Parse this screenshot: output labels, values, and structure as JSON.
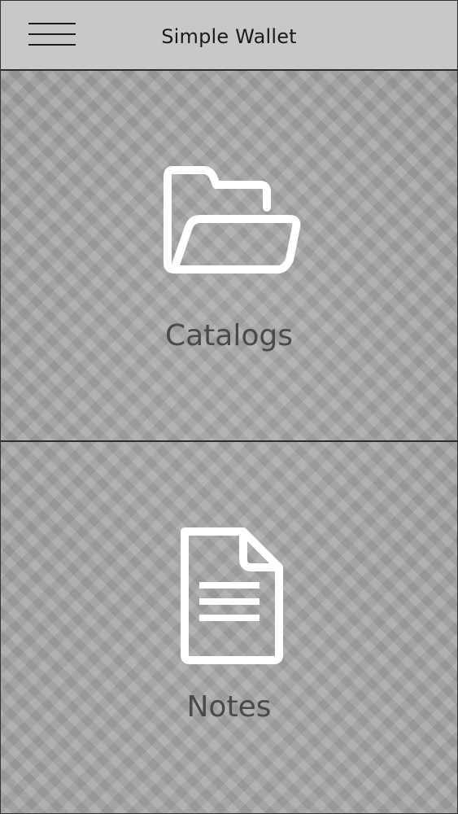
{
  "header": {
    "title": "Simple Wallet",
    "menu_icon": "hamburger-menu-icon"
  },
  "tiles": [
    {
      "label": "Catalogs",
      "icon": "folder-open-icon"
    },
    {
      "label": "Notes",
      "icon": "document-icon"
    }
  ],
  "colors": {
    "header_bg": "#c8c8c8",
    "icon_stroke": "#ffffff",
    "tile_text": "#4a4a4a",
    "divider": "#2d2d2d"
  }
}
